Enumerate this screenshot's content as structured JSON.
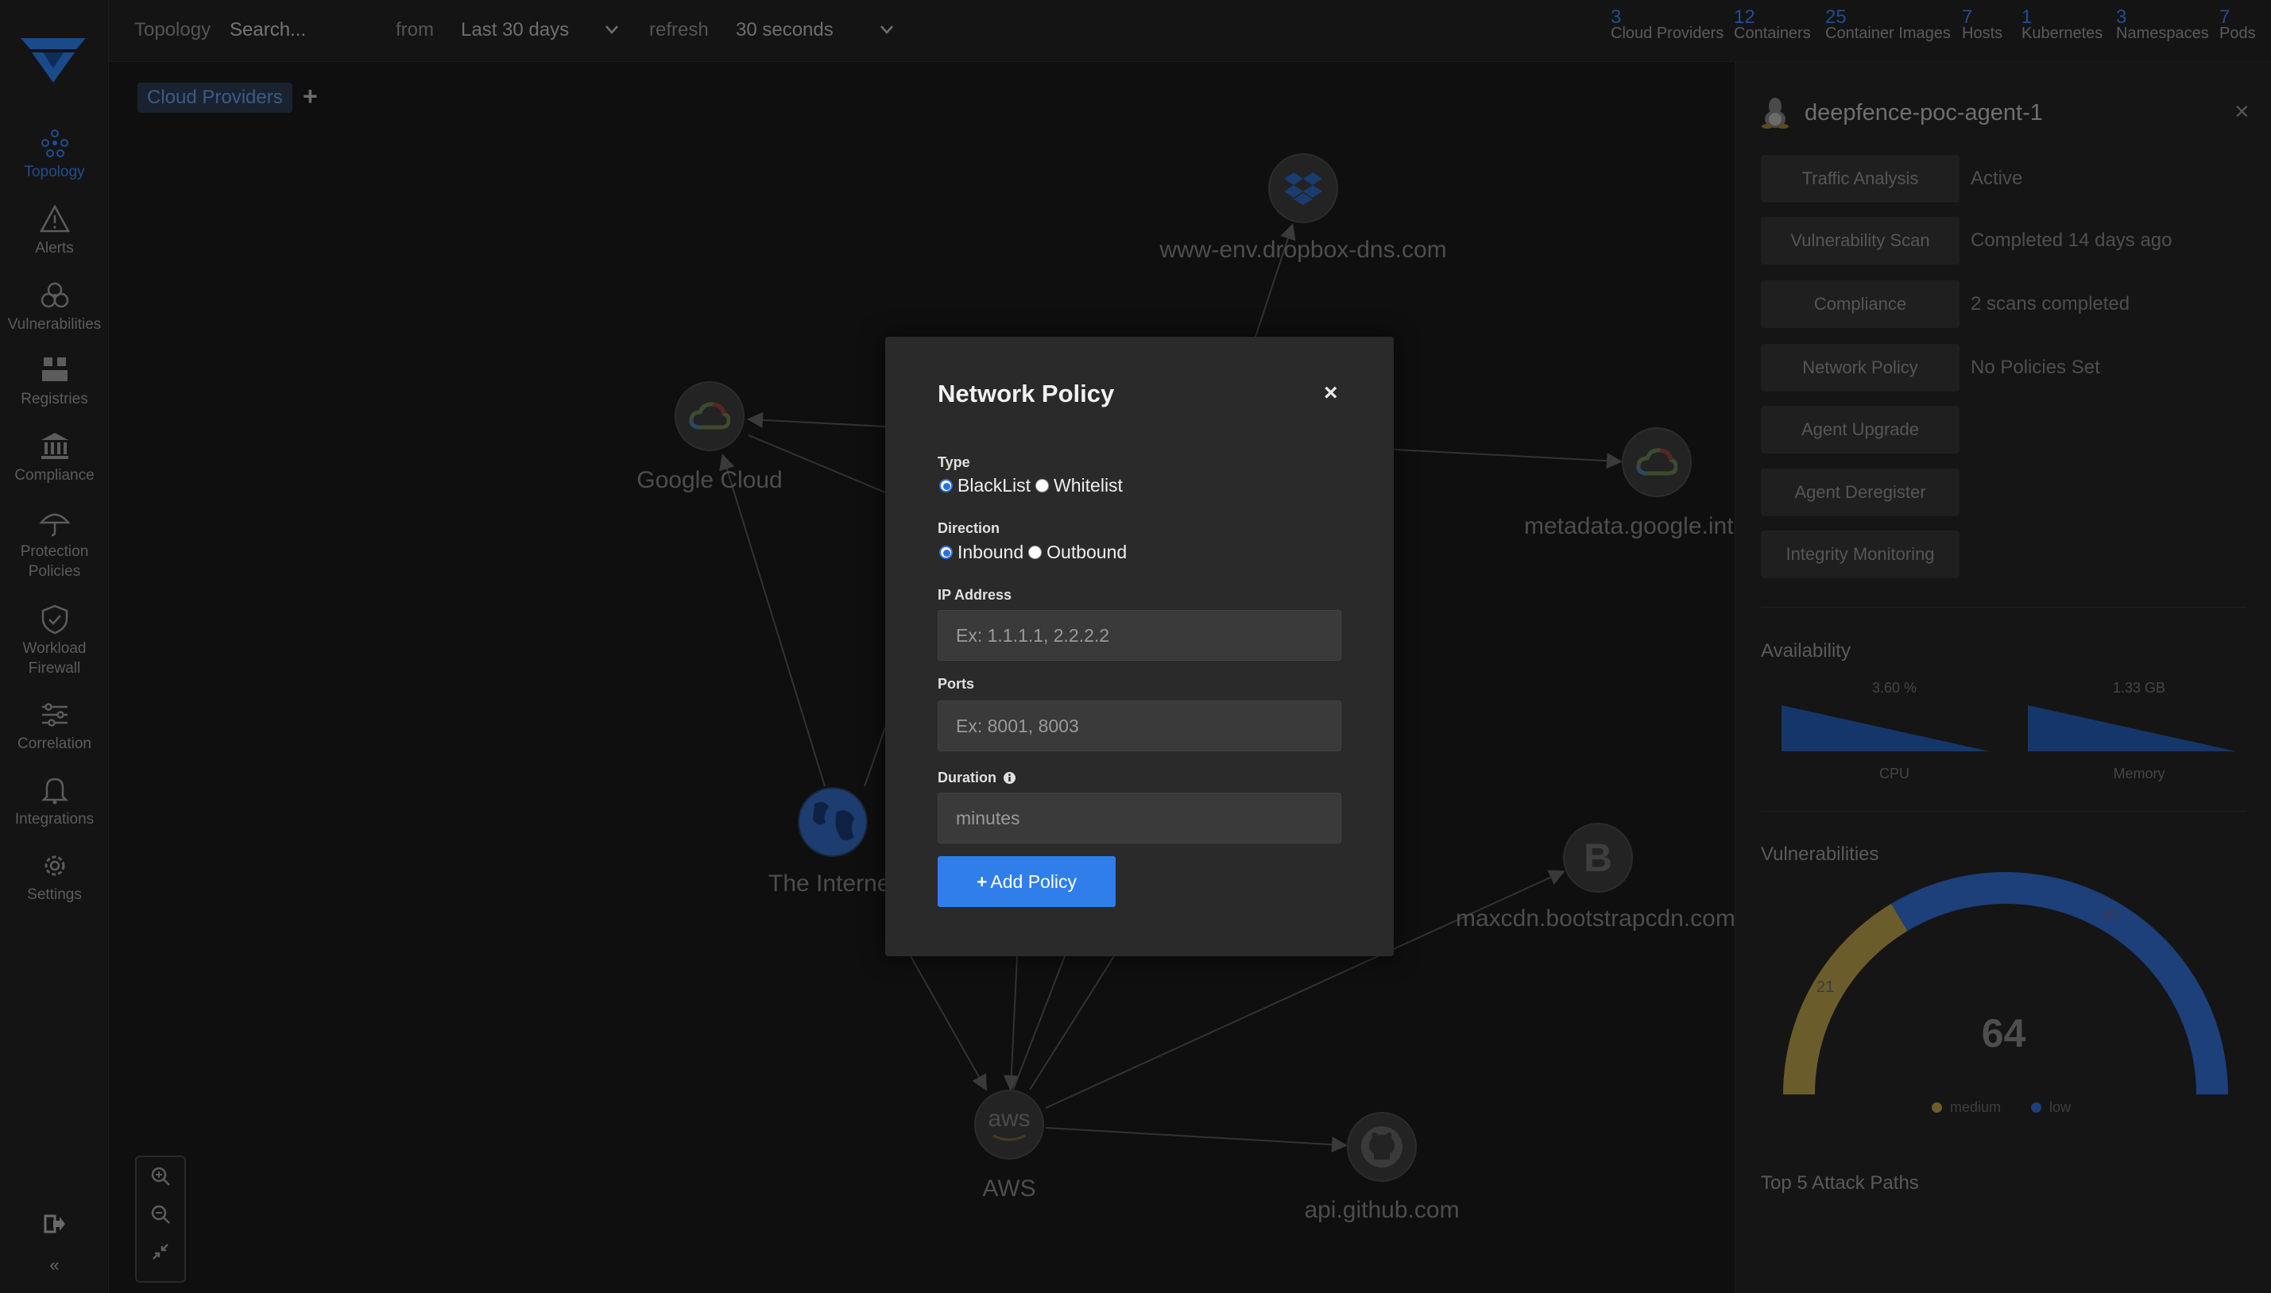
{
  "sidebar": {
    "items": [
      {
        "label": "Topology",
        "icon": "topology-icon"
      },
      {
        "label": "Alerts",
        "icon": "alert-triangle-icon"
      },
      {
        "label": "Vulnerabilities",
        "icon": "biohazard-icon"
      },
      {
        "label": "Registries",
        "icon": "boxes-icon"
      },
      {
        "label": "Compliance",
        "icon": "bank-icon"
      },
      {
        "label": "Protection Policies",
        "icon": "umbrella-icon"
      },
      {
        "label": "Workload Firewall",
        "icon": "shield-icon"
      },
      {
        "label": "Correlation",
        "icon": "sliders-icon"
      },
      {
        "label": "Integrations",
        "icon": "bell-icon"
      },
      {
        "label": "Settings",
        "icon": "gear-icon"
      }
    ],
    "collapse_glyph": "«"
  },
  "topbar": {
    "section": "Topology",
    "search_placeholder": "Search...",
    "from_label": "from",
    "from_value": "Last 30 days",
    "refresh_label": "refresh",
    "refresh_value": "30 seconds",
    "counts": [
      {
        "n": "3",
        "label": "Cloud Providers"
      },
      {
        "n": "12",
        "label": "Containers"
      },
      {
        "n": "25",
        "label": "Container Images"
      },
      {
        "n": "7",
        "label": "Hosts"
      },
      {
        "n": "1",
        "label": "Kubernetes"
      },
      {
        "n": "3",
        "label": "Namespaces"
      },
      {
        "n": "7",
        "label": "Pods"
      }
    ]
  },
  "graph": {
    "tag": "Cloud Providers",
    "tag_add": "+",
    "nodes": [
      {
        "label": "www-env.dropbox-dns.com",
        "icon": "dropbox-icon"
      },
      {
        "label": "Google Cloud",
        "icon": "google-cloud-icon"
      },
      {
        "label": "metadata.google.int",
        "icon": "google-cloud-icon"
      },
      {
        "label": "The Interne",
        "icon": "globe-icon"
      },
      {
        "label": "maxcdn.bootstrapcdn.com",
        "icon": "bootstrap-icon"
      },
      {
        "label": "AWS",
        "icon": "aws-icon"
      },
      {
        "label": "api.github.com",
        "icon": "github-icon"
      }
    ],
    "bootstrap_letter": "B",
    "aws_text": "aws"
  },
  "panel": {
    "title": "deepfence-poc-agent-1",
    "close": "×",
    "rows": [
      {
        "button": "Traffic Analysis",
        "value": "Active"
      },
      {
        "button": "Vulnerability Scan",
        "value": "Completed 14 days ago"
      },
      {
        "button": "Compliance",
        "value": "2 scans completed"
      },
      {
        "button": "Network Policy",
        "value": "No Policies Set"
      },
      {
        "button": "Agent Upgrade",
        "value": ""
      },
      {
        "button": "Agent Deregister",
        "value": ""
      },
      {
        "button": "Integrity Monitoring",
        "value": ""
      }
    ],
    "availability": {
      "title": "Availability",
      "cpu_value": "3.60 %",
      "cpu_label": "CPU",
      "mem_value": "1.33 GB",
      "mem_label": "Memory"
    },
    "vulnerabilities": {
      "title": "Vulnerabilities",
      "total": "64",
      "medium_count": "21",
      "low_count": "43",
      "legend_medium": "medium",
      "legend_low": "low",
      "medium_color": "#6b5c2c",
      "low_color": "#1d3f7a"
    },
    "attack_paths_title": "Top 5 Attack Paths"
  },
  "modal": {
    "title": "Network Policy",
    "close": "×",
    "type_label": "Type",
    "type_options": [
      "BlackList",
      "Whitelist"
    ],
    "type_selected": "BlackList",
    "direction_label": "Direction",
    "direction_options": [
      "Inbound",
      "Outbound"
    ],
    "direction_selected": "Inbound",
    "ip_label": "IP Address",
    "ip_placeholder": "Ex: 1.1.1.1, 2.2.2.2",
    "ports_label": "Ports",
    "ports_placeholder": "Ex: 8001, 8003",
    "duration_label": "Duration",
    "duration_placeholder": "minutes",
    "submit_label": "Add Policy",
    "accent_color": "#2f7eea"
  }
}
